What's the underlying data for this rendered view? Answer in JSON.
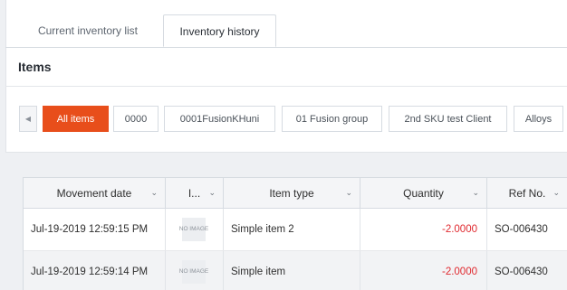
{
  "tabs": [
    {
      "label": "Current inventory list",
      "active": false
    },
    {
      "label": "Inventory history",
      "active": true
    }
  ],
  "section": {
    "title": "Items"
  },
  "chips": {
    "items": [
      "All items",
      "0000",
      "0001FusionKHuni",
      "01 Fusion group",
      "2nd SKU test Client",
      "Alloys"
    ],
    "active_index": 0,
    "active_color": "#e84e1b"
  },
  "table": {
    "columns": [
      "Movement date",
      "I...",
      "Item type",
      "Quantity",
      "Ref No."
    ],
    "rows": [
      {
        "date": "Jul-19-2019 12:59:15 PM",
        "image": "NO IMAGE",
        "item": "Simple item 2",
        "quantity": "-2.0000",
        "ref": "SO-006430"
      },
      {
        "date": "Jul-19-2019 12:59:14 PM",
        "image": "NO IMAGE",
        "item": "Simple item",
        "quantity": "-2.0000",
        "ref": "SO-006430"
      }
    ],
    "negative_color": "#e0292f"
  },
  "icons": {
    "scroll_left": "caret-left-icon",
    "sort": "chevron-down-icon"
  }
}
